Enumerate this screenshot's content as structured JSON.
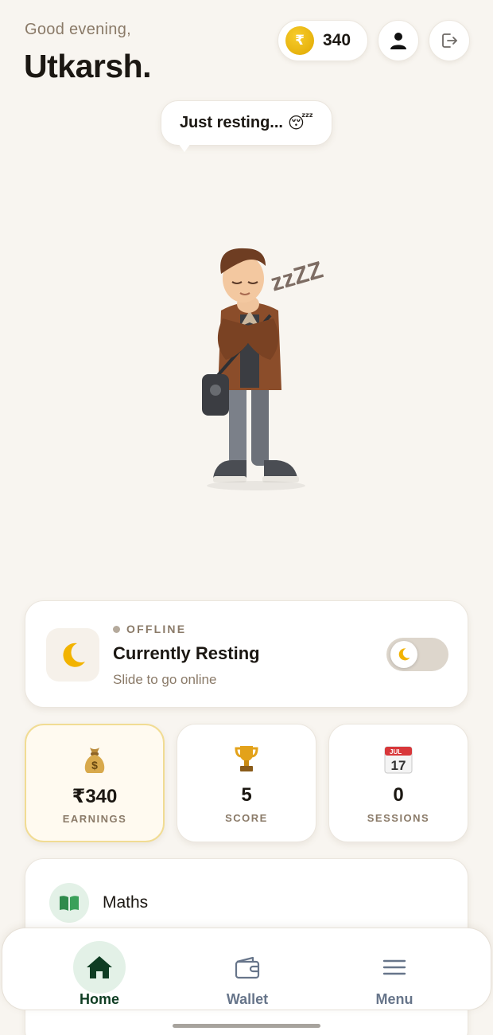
{
  "header": {
    "greeting": "Good evening,",
    "user_name": "Utkarsh.",
    "coins": {
      "symbol": "₹",
      "value": "340"
    },
    "profile_icon": "person-icon",
    "logout_icon": "logout-icon"
  },
  "mascot": {
    "speech": "Just resting...",
    "speech_emoji": "😴",
    "snore": "zzZZ"
  },
  "status": {
    "indicator_label": "OFFLINE",
    "title": "Currently Resting",
    "subtitle": "Slide to go online",
    "icon": "moon-icon",
    "online": false
  },
  "stats": [
    {
      "icon": "money-bag-icon",
      "value": "₹340",
      "label": "EARNINGS",
      "highlighted": true
    },
    {
      "icon": "trophy-icon",
      "value": "5",
      "label": "SCORE",
      "highlighted": false
    },
    {
      "icon": "calendar-icon",
      "value": "0",
      "label": "SESSIONS",
      "highlighted": false,
      "calendar_month": "JUL",
      "calendar_day": "17"
    }
  ],
  "subjects": [
    {
      "icon": "book-icon",
      "name": "Maths"
    }
  ],
  "nav": [
    {
      "label": "Home",
      "icon": "home-icon",
      "active": true
    },
    {
      "label": "Wallet",
      "icon": "wallet-icon",
      "active": false
    },
    {
      "label": "Menu",
      "icon": "menu-icon",
      "active": false
    }
  ],
  "colors": {
    "background": "#f8f5f0",
    "accent_green": "#0f3d23",
    "muted_text": "#8a7a68",
    "coin_gold": "#e9b409"
  }
}
